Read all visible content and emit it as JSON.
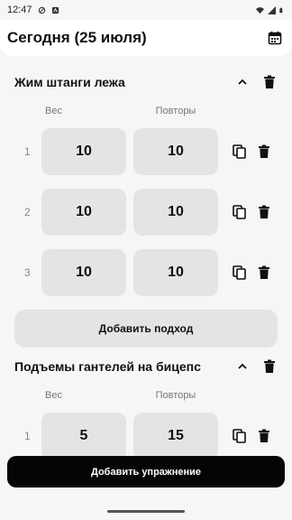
{
  "status_bar": {
    "time": "12:47",
    "icons": [
      "vpn-key-icon",
      "notification-icon",
      "wifi-icon",
      "signal-icon",
      "battery-icon"
    ]
  },
  "header": {
    "title": "Сегодня (25 июля)",
    "calendar_icon": "calendar-icon"
  },
  "exercises": [
    {
      "name": "Жим штанги лежа",
      "weight_label": "Вес",
      "reps_label": "Повторы",
      "sets": [
        {
          "num": "1",
          "weight": "10",
          "reps": "10"
        },
        {
          "num": "2",
          "weight": "10",
          "reps": "10"
        },
        {
          "num": "3",
          "weight": "10",
          "reps": "10"
        }
      ],
      "add_set_label": "Добавить подход"
    },
    {
      "name": "Подъемы гантелей на бицепс",
      "weight_label": "Вес",
      "reps_label": "Повторы",
      "sets": [
        {
          "num": "1",
          "weight": "5",
          "reps": "15"
        }
      ]
    }
  ],
  "add_exercise_label": "Добавить упражнение",
  "colors": {
    "background": "#f6f6f6",
    "field": "#e4e4e4",
    "primary_button": "#050505"
  }
}
